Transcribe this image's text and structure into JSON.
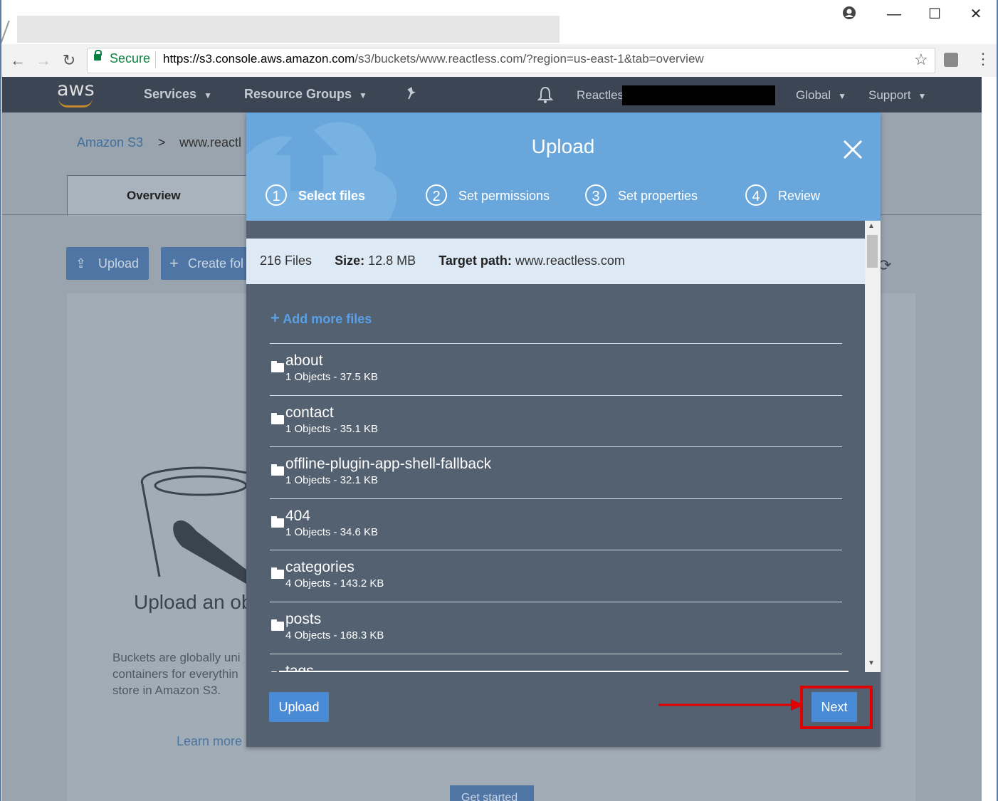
{
  "browser": {
    "secure_label": "Secure",
    "url_host": "https://s3.console.aws.amazon.com",
    "url_path": "/s3/buckets/www.reactless.com/?region=us-east-1&tab=overview",
    "window_controls": {
      "minimize": "—",
      "maximize": "☐",
      "close": "✕"
    }
  },
  "aws_nav": {
    "logo": "aws",
    "services": "Services",
    "resource_groups": "Resource Groups",
    "account": "Reactles",
    "region": "Global",
    "support": "Support"
  },
  "page": {
    "breadcrumb_root": "Amazon S3",
    "breadcrumb_sep": ">",
    "breadcrumb_bucket": "www.reactl",
    "tab_overview": "Overview",
    "upload_button": "Upload",
    "create_folder_button": "Create fol",
    "empty_heading": "Upload an ob",
    "empty_desc_lines": [
      "Buckets are globally uni",
      "containers for everythin",
      "store in Amazon S3."
    ],
    "learn_more": "Learn more",
    "get_started": "Get started"
  },
  "modal": {
    "title": "Upload",
    "steps": [
      {
        "num": "1",
        "label": "Select files",
        "active": true
      },
      {
        "num": "2",
        "label": "Set permissions",
        "active": false
      },
      {
        "num": "3",
        "label": "Set properties",
        "active": false
      },
      {
        "num": "4",
        "label": "Review",
        "active": false
      }
    ],
    "summary": {
      "files": "216 Files",
      "size_label": "Size:",
      "size_value": "12.8 MB",
      "target_label": "Target path:",
      "target_value": "www.reactless.com"
    },
    "add_more": "Add more files",
    "items": [
      {
        "name": "about",
        "meta": "1 Objects - 37.5 KB"
      },
      {
        "name": "contact",
        "meta": "1 Objects - 35.1 KB"
      },
      {
        "name": "offline-plugin-app-shell-fallback",
        "meta": "1 Objects - 32.1 KB"
      },
      {
        "name": "404",
        "meta": "1 Objects - 34.6 KB"
      },
      {
        "name": "categories",
        "meta": "4 Objects - 143.2 KB"
      },
      {
        "name": "posts",
        "meta": "4 Objects - 168.3 KB"
      },
      {
        "name": "tags",
        "meta": ""
      }
    ],
    "upload_button": "Upload",
    "next_button": "Next"
  },
  "colors": {
    "accent": "#4a8bd6",
    "header": "#68a6db",
    "modal_body": "#536170",
    "annotation": "#e00000"
  }
}
